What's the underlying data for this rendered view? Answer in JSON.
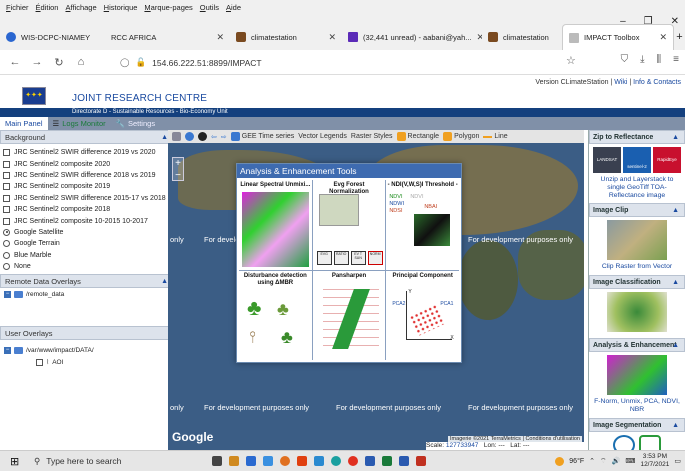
{
  "menu": [
    "Fichier",
    "Édition",
    "Affichage",
    "Historique",
    "Marque-pages",
    "Outils",
    "Aide"
  ],
  "tabs": [
    {
      "label": "WIS-DCPC-NIAMEY",
      "color": "#2a66d0"
    },
    {
      "label": "RCC AFRICA",
      "color": ""
    },
    {
      "label": "climatestation",
      "color": "#7a4a20"
    },
    {
      "label": "(32,441 unread) - aabani@yah...",
      "color": "#5b2bb8"
    },
    {
      "label": "climatestation",
      "color": "#7a4a20"
    },
    {
      "label": "IMPACT Toolbox",
      "color": "#bbb",
      "active": true
    }
  ],
  "url": "154.66.222.51:8899/IMPACT",
  "app": {
    "version_text": "Version CLimateStation",
    "wiki": "Wiki",
    "info": "Info & Contacts",
    "org": "JOINT RESEARCH CENTRE",
    "directorate": "Directorate D - Sustainable Resources - Bio-Economy Unit",
    "tabs": [
      "Main Panel",
      "Logs Monitor",
      "Settings"
    ]
  },
  "left": {
    "background_title": "Background",
    "layers": [
      "JRC Sentinel2 SWIR difference 2019 vs 2020",
      "JRC Sentinel2 composite 2020",
      "JRC Sentinel2 SWIR difference 2018 vs 2019",
      "JRC Sentinel2 composite 2019",
      "JRC Sentinel2 SWIR difference 2015-17 vs 2018",
      "JRC Sentinel2 composite 2018",
      "JRC Sentinel2 composite 10-2015 10-2017"
    ],
    "basemaps": [
      "Google Satellite",
      "Google Terrain",
      "Blue Marble",
      "None"
    ],
    "remote_title": "Remote Data Overlays",
    "remote_folder": "/remote_data",
    "user_title": "User Overlays",
    "user_folder": "/var/www/impact/DATA/",
    "user_item": "AOI"
  },
  "map": {
    "toolbar": [
      "GEE Time series",
      "Vector Legends",
      "Raster Styles",
      "Rectangle",
      "Polygon",
      "Line"
    ],
    "dev_text": "For development purposes only",
    "dev_short": "only",
    "google": "Google",
    "scale_label": "Scale:",
    "scale_value": "127733947",
    "lon_label": "Lon:",
    "lon_value": "---",
    "lat_label": "Lat:",
    "lat_value": "---",
    "imagery": "Imagerie ©2021 TerraMetrics",
    "conditions": "Conditions d'utilisation"
  },
  "modal": {
    "title": "Analysis & Enhancement Tools",
    "tools": [
      "Linear Spectral Unmixi...",
      "Evg Forest Normalization",
      "- NDI(V,W,S)I Threshold -",
      "Disturbance detection using ΔMBR",
      "Pansharpen",
      "Principal Component"
    ],
    "ndi": [
      "NDVI",
      "NDWI",
      "NDSI",
      "NBAI",
      "NDVI"
    ],
    "pca": [
      "PCA2",
      "PCA1",
      "Y",
      "X"
    ],
    "evg_boxes": [
      "EVG",
      "RATIO",
      "EV T SUN",
      "NORM"
    ]
  },
  "right": {
    "sections": [
      {
        "title": "Zip to Reflectance",
        "text": "Unzip and Layerstack to single GeoTiff TOA-Reflectance image",
        "badges": [
          "LANDSAT",
          "sentinel-2",
          "RapidEye"
        ]
      },
      {
        "title": "Image Clip",
        "text": "Clip Raster from Vector"
      },
      {
        "title": "Image Classification",
        "text": ""
      },
      {
        "title": "Analysis & Enhancement",
        "text": "F-Norm, Unmix, PCA, NDVI, NBR"
      },
      {
        "title": "Image Segmentation",
        "text": ""
      }
    ]
  },
  "taskbar": {
    "search_placeholder": "Type here to search",
    "temp": "96°F",
    "time": "3:53 PM",
    "date": "12/7/2021"
  }
}
